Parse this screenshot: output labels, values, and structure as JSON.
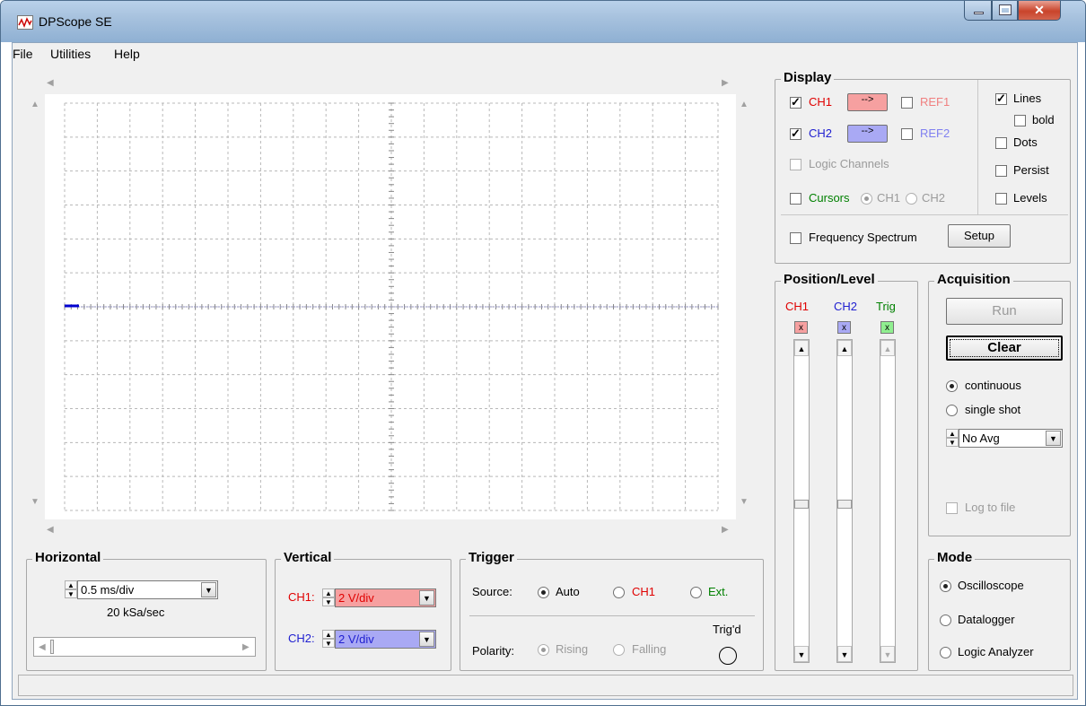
{
  "window": {
    "title": "DPScope SE"
  },
  "menu": {
    "file": "File",
    "utilities": "Utilities",
    "help": "Help"
  },
  "display": {
    "title": "Display",
    "ch1": "CH1",
    "ch1_arrow": "-->",
    "ch1_checked": true,
    "ch2": "CH2",
    "ch2_arrow": "-->",
    "ch2_checked": true,
    "ref1": "REF1",
    "ref2": "REF2",
    "logic_channels": "Logic Channels",
    "cursors": "Cursors",
    "cursor_ch1": "CH1",
    "cursor_ch2": "CH2",
    "lines": "Lines",
    "lines_checked": true,
    "bold": "bold",
    "dots": "Dots",
    "persist": "Persist",
    "levels": "Levels",
    "frequency_spectrum": "Frequency Spectrum",
    "setup": "Setup"
  },
  "position": {
    "title": "Position/Level",
    "ch1": "CH1",
    "ch2": "CH2",
    "trig": "Trig",
    "reset": "x"
  },
  "acquisition": {
    "title": "Acquisition",
    "run": "Run",
    "clear": "Clear",
    "continuous": "continuous",
    "single_shot": "single shot",
    "averaging": "No Avg",
    "log_to_file": "Log to file"
  },
  "mode": {
    "title": "Mode",
    "oscilloscope": "Oscilloscope",
    "datalogger": "Datalogger",
    "logic_analyzer": "Logic Analyzer"
  },
  "horizontal": {
    "title": "Horizontal",
    "timebase": "0.5 ms/div",
    "sample_rate": "20 kSa/sec"
  },
  "vertical": {
    "title": "Vertical",
    "ch1_label": "CH1:",
    "ch1_scale": "2 V/div",
    "ch2_label": "CH2:",
    "ch2_scale": "2 V/div"
  },
  "trigger": {
    "title": "Trigger",
    "source_label": "Source:",
    "auto": "Auto",
    "ch1": "CH1",
    "ext": "Ext.",
    "polarity_label": "Polarity:",
    "rising": "Rising",
    "falling": "Falling",
    "trigd": "Trig'd"
  },
  "colors": {
    "ch1": "#e00000",
    "ch2": "#2020d0",
    "trig": "#008000",
    "ch1_btn": "#f6a0a0",
    "ch2_btn": "#a9a9f4",
    "trig_btn": "#90ef90"
  }
}
